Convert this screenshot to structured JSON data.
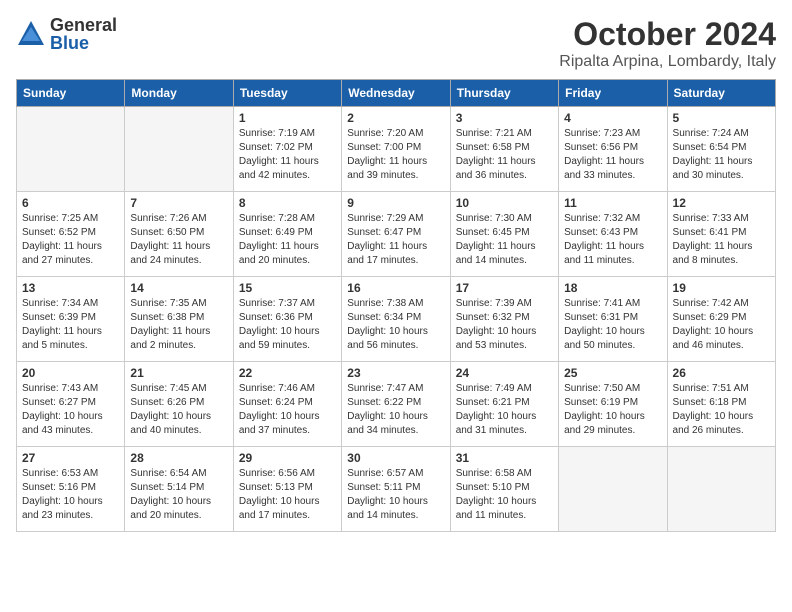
{
  "header": {
    "logo_general": "General",
    "logo_blue": "Blue",
    "month_title": "October 2024",
    "location": "Ripalta Arpina, Lombardy, Italy"
  },
  "days_of_week": [
    "Sunday",
    "Monday",
    "Tuesday",
    "Wednesday",
    "Thursday",
    "Friday",
    "Saturday"
  ],
  "weeks": [
    [
      {
        "day": "",
        "empty": true
      },
      {
        "day": "",
        "empty": true
      },
      {
        "day": "1",
        "sunrise": "Sunrise: 7:19 AM",
        "sunset": "Sunset: 7:02 PM",
        "daylight": "Daylight: 11 hours and 42 minutes."
      },
      {
        "day": "2",
        "sunrise": "Sunrise: 7:20 AM",
        "sunset": "Sunset: 7:00 PM",
        "daylight": "Daylight: 11 hours and 39 minutes."
      },
      {
        "day": "3",
        "sunrise": "Sunrise: 7:21 AM",
        "sunset": "Sunset: 6:58 PM",
        "daylight": "Daylight: 11 hours and 36 minutes."
      },
      {
        "day": "4",
        "sunrise": "Sunrise: 7:23 AM",
        "sunset": "Sunset: 6:56 PM",
        "daylight": "Daylight: 11 hours and 33 minutes."
      },
      {
        "day": "5",
        "sunrise": "Sunrise: 7:24 AM",
        "sunset": "Sunset: 6:54 PM",
        "daylight": "Daylight: 11 hours and 30 minutes."
      }
    ],
    [
      {
        "day": "6",
        "sunrise": "Sunrise: 7:25 AM",
        "sunset": "Sunset: 6:52 PM",
        "daylight": "Daylight: 11 hours and 27 minutes."
      },
      {
        "day": "7",
        "sunrise": "Sunrise: 7:26 AM",
        "sunset": "Sunset: 6:50 PM",
        "daylight": "Daylight: 11 hours and 24 minutes."
      },
      {
        "day": "8",
        "sunrise": "Sunrise: 7:28 AM",
        "sunset": "Sunset: 6:49 PM",
        "daylight": "Daylight: 11 hours and 20 minutes."
      },
      {
        "day": "9",
        "sunrise": "Sunrise: 7:29 AM",
        "sunset": "Sunset: 6:47 PM",
        "daylight": "Daylight: 11 hours and 17 minutes."
      },
      {
        "day": "10",
        "sunrise": "Sunrise: 7:30 AM",
        "sunset": "Sunset: 6:45 PM",
        "daylight": "Daylight: 11 hours and 14 minutes."
      },
      {
        "day": "11",
        "sunrise": "Sunrise: 7:32 AM",
        "sunset": "Sunset: 6:43 PM",
        "daylight": "Daylight: 11 hours and 11 minutes."
      },
      {
        "day": "12",
        "sunrise": "Sunrise: 7:33 AM",
        "sunset": "Sunset: 6:41 PM",
        "daylight": "Daylight: 11 hours and 8 minutes."
      }
    ],
    [
      {
        "day": "13",
        "sunrise": "Sunrise: 7:34 AM",
        "sunset": "Sunset: 6:39 PM",
        "daylight": "Daylight: 11 hours and 5 minutes."
      },
      {
        "day": "14",
        "sunrise": "Sunrise: 7:35 AM",
        "sunset": "Sunset: 6:38 PM",
        "daylight": "Daylight: 11 hours and 2 minutes."
      },
      {
        "day": "15",
        "sunrise": "Sunrise: 7:37 AM",
        "sunset": "Sunset: 6:36 PM",
        "daylight": "Daylight: 10 hours and 59 minutes."
      },
      {
        "day": "16",
        "sunrise": "Sunrise: 7:38 AM",
        "sunset": "Sunset: 6:34 PM",
        "daylight": "Daylight: 10 hours and 56 minutes."
      },
      {
        "day": "17",
        "sunrise": "Sunrise: 7:39 AM",
        "sunset": "Sunset: 6:32 PM",
        "daylight": "Daylight: 10 hours and 53 minutes."
      },
      {
        "day": "18",
        "sunrise": "Sunrise: 7:41 AM",
        "sunset": "Sunset: 6:31 PM",
        "daylight": "Daylight: 10 hours and 50 minutes."
      },
      {
        "day": "19",
        "sunrise": "Sunrise: 7:42 AM",
        "sunset": "Sunset: 6:29 PM",
        "daylight": "Daylight: 10 hours and 46 minutes."
      }
    ],
    [
      {
        "day": "20",
        "sunrise": "Sunrise: 7:43 AM",
        "sunset": "Sunset: 6:27 PM",
        "daylight": "Daylight: 10 hours and 43 minutes."
      },
      {
        "day": "21",
        "sunrise": "Sunrise: 7:45 AM",
        "sunset": "Sunset: 6:26 PM",
        "daylight": "Daylight: 10 hours and 40 minutes."
      },
      {
        "day": "22",
        "sunrise": "Sunrise: 7:46 AM",
        "sunset": "Sunset: 6:24 PM",
        "daylight": "Daylight: 10 hours and 37 minutes."
      },
      {
        "day": "23",
        "sunrise": "Sunrise: 7:47 AM",
        "sunset": "Sunset: 6:22 PM",
        "daylight": "Daylight: 10 hours and 34 minutes."
      },
      {
        "day": "24",
        "sunrise": "Sunrise: 7:49 AM",
        "sunset": "Sunset: 6:21 PM",
        "daylight": "Daylight: 10 hours and 31 minutes."
      },
      {
        "day": "25",
        "sunrise": "Sunrise: 7:50 AM",
        "sunset": "Sunset: 6:19 PM",
        "daylight": "Daylight: 10 hours and 29 minutes."
      },
      {
        "day": "26",
        "sunrise": "Sunrise: 7:51 AM",
        "sunset": "Sunset: 6:18 PM",
        "daylight": "Daylight: 10 hours and 26 minutes."
      }
    ],
    [
      {
        "day": "27",
        "sunrise": "Sunrise: 6:53 AM",
        "sunset": "Sunset: 5:16 PM",
        "daylight": "Daylight: 10 hours and 23 minutes."
      },
      {
        "day": "28",
        "sunrise": "Sunrise: 6:54 AM",
        "sunset": "Sunset: 5:14 PM",
        "daylight": "Daylight: 10 hours and 20 minutes."
      },
      {
        "day": "29",
        "sunrise": "Sunrise: 6:56 AM",
        "sunset": "Sunset: 5:13 PM",
        "daylight": "Daylight: 10 hours and 17 minutes."
      },
      {
        "day": "30",
        "sunrise": "Sunrise: 6:57 AM",
        "sunset": "Sunset: 5:11 PM",
        "daylight": "Daylight: 10 hours and 14 minutes."
      },
      {
        "day": "31",
        "sunrise": "Sunrise: 6:58 AM",
        "sunset": "Sunset: 5:10 PM",
        "daylight": "Daylight: 10 hours and 11 minutes."
      },
      {
        "day": "",
        "empty": true
      },
      {
        "day": "",
        "empty": true
      }
    ]
  ]
}
